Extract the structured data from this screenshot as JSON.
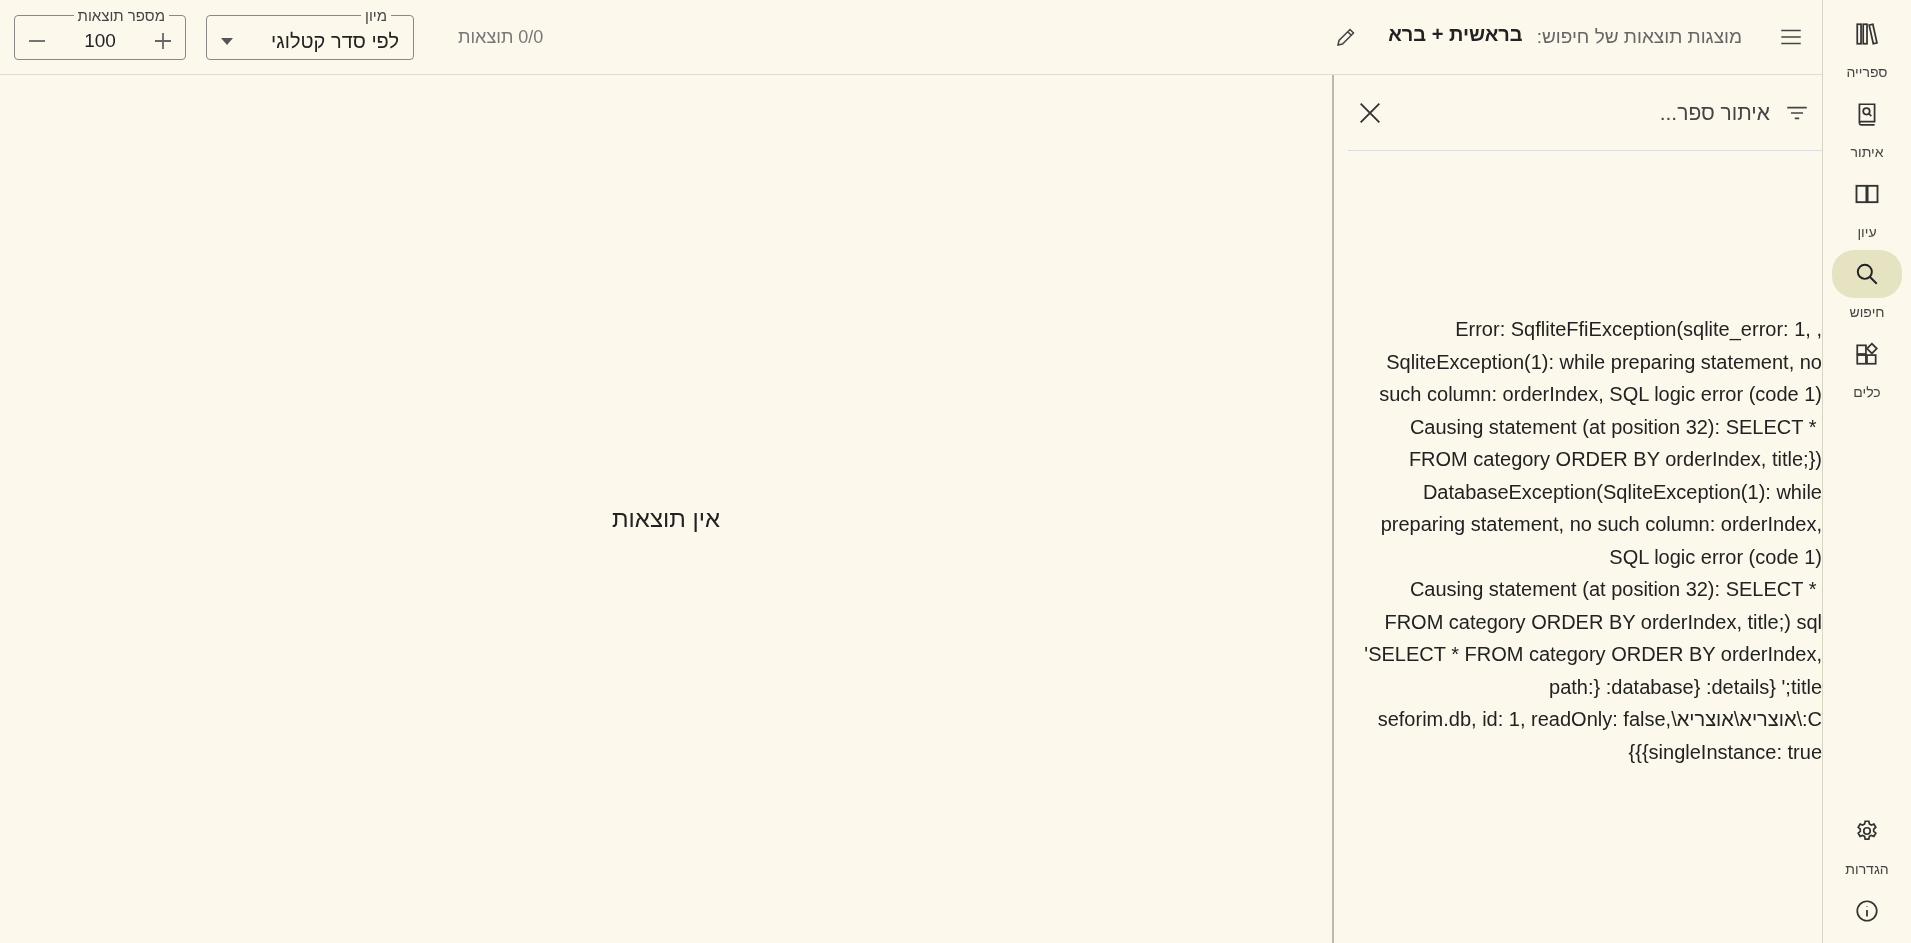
{
  "top_bar": {
    "heading_label": "מוצגות תוצאות של חיפוש:",
    "query": "בראשית + ברא",
    "results_count": "0/0 תוצאות",
    "sort": {
      "legend": "מיון",
      "value": "לפי סדר קטלוגי"
    },
    "page_size": {
      "legend": "מספר תוצאות",
      "value": "100"
    }
  },
  "results": {
    "empty_message": "אין תוצאות"
  },
  "book_filter": {
    "placeholder": "איתור ספר...",
    "error": "Error: SqfliteFfiException(sqlite_error: 1, , SqliteException(1): while preparing statement, no such column: orderIndex, SQL logic error (code 1)\n Causing statement (at position 32): SELECT * FROM category ORDER BY orderIndex, title;}) DatabaseException(SqliteException(1): while preparing statement, no such column: orderIndex, SQL logic error (code 1)\n Causing statement (at position 32): SELECT * FROM category ORDER BY orderIndex, title;) sql 'SELECT * FROM category ORDER BY orderIndex, title;' {details: {database: {path: C:\\אוצריא\\אוצריא\\seforim.db, id: 1, readOnly: false, singleInstance: true}}}"
  },
  "rail": {
    "items": [
      {
        "kind": "library",
        "label": "ספרייה",
        "selected": false
      },
      {
        "kind": "find",
        "label": "איתור",
        "selected": false
      },
      {
        "kind": "read",
        "label": "עיון",
        "selected": false
      },
      {
        "kind": "search",
        "label": "חיפוש",
        "selected": true
      },
      {
        "kind": "tools",
        "label": "כלים",
        "selected": false
      }
    ],
    "bottom_items": [
      {
        "kind": "settings",
        "label": "הגדרות",
        "selected": false
      },
      {
        "kind": "info",
        "selected": false
      }
    ]
  }
}
